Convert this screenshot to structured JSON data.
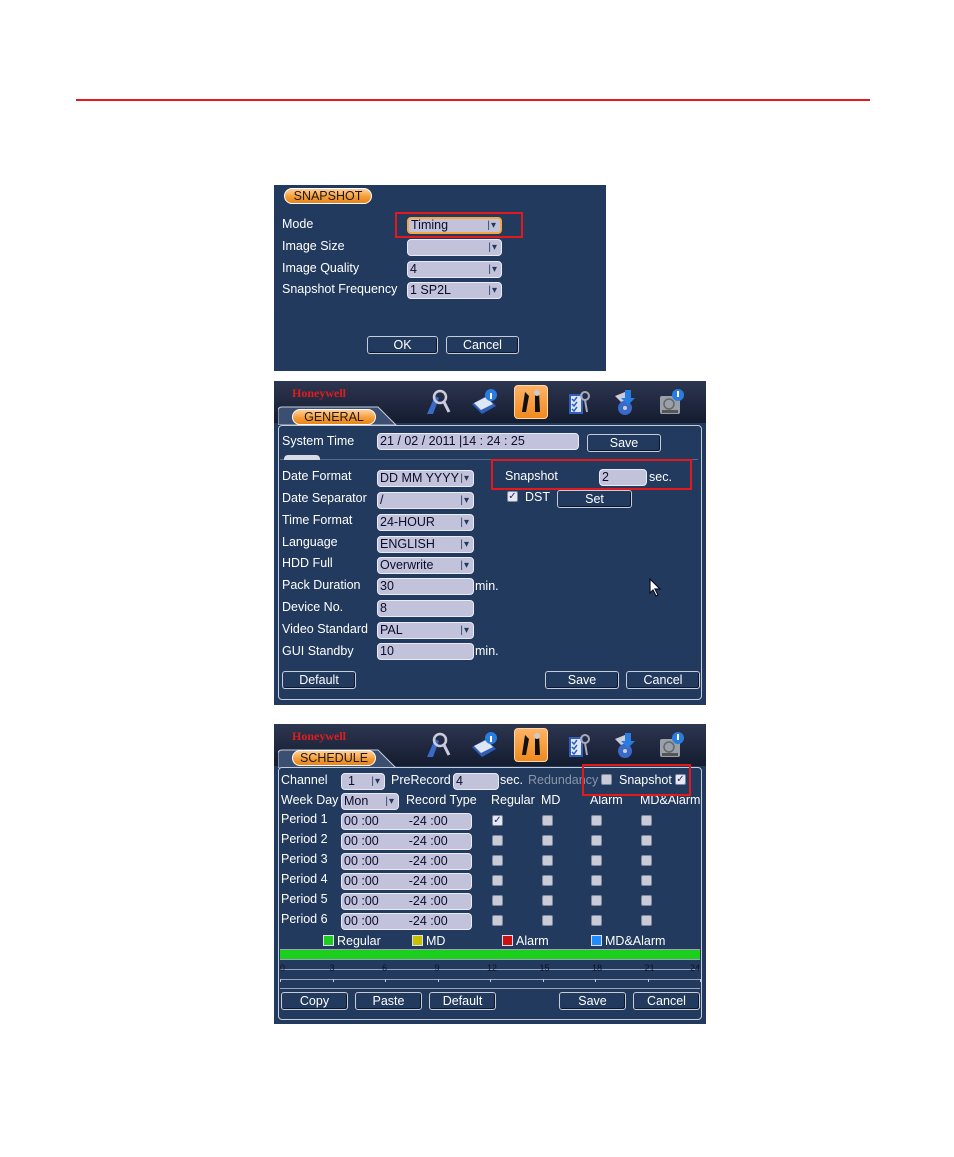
{
  "colors": {
    "rule": "#e3191b",
    "panel_bg": "#223a5e",
    "field_bg": "#c2c3db",
    "tab_orange": "#f59a32",
    "brand_red": "#e01c1c",
    "highlight_box": "#e3191b",
    "legend_regular": "#1ccf1c",
    "legend_md": "#c8c000",
    "legend_alarm": "#cc1010",
    "legend_md_alarm": "#1e8cff"
  },
  "snapshot_dialog": {
    "tab": "SNAPSHOT",
    "rows": [
      {
        "label": "Mode",
        "value": "Timing",
        "type": "select"
      },
      {
        "label": "Image Size",
        "value": "",
        "type": "select"
      },
      {
        "label": "Image Quality",
        "value": "4",
        "type": "select"
      },
      {
        "label": "Snapshot Frequency",
        "value": "1 SP2L",
        "type": "select"
      }
    ],
    "ok": "OK",
    "cancel": "Cancel"
  },
  "general_dialog": {
    "brand": "Honeywell",
    "menu_icons": [
      "search-icon",
      "info-icon",
      "settings-tools-icon",
      "security-checklist-icon",
      "backup-icon",
      "shutdown-icon"
    ],
    "tab": "GENERAL",
    "system_time_label": "System Time",
    "system_time_value": "21 / 02 / 2011   |14 : 24 : 25",
    "save_time": "Save",
    "rows": [
      {
        "label": "Date Format",
        "value": "DD MM YYYY",
        "type": "select"
      },
      {
        "label": "Date Separator",
        "value": "/",
        "type": "select"
      },
      {
        "label": "Time Format",
        "value": "24-HOUR",
        "type": "select"
      },
      {
        "label": "Language",
        "value": "ENGLISH",
        "type": "select"
      },
      {
        "label": "HDD Full",
        "value": "Overwrite",
        "type": "select"
      },
      {
        "label": "Pack Duration",
        "value": "30",
        "type": "input",
        "unit": "min."
      },
      {
        "label": "Device No.",
        "value": "8",
        "type": "input"
      },
      {
        "label": "Video Standard",
        "value": "PAL",
        "type": "select"
      },
      {
        "label": "GUI Standby",
        "value": "10",
        "type": "input",
        "unit": "min."
      }
    ],
    "snapshot_label": "Snapshot",
    "snapshot_value": "2",
    "snapshot_unit": "sec.",
    "dst_label": "DST",
    "dst_checked": true,
    "set": "Set",
    "default": "Default",
    "save": "Save",
    "cancel": "Cancel"
  },
  "schedule_dialog": {
    "brand": "Honeywell",
    "tab": "SCHEDULE",
    "channel_label": "Channel",
    "channel_value": "1",
    "prerecord_label": "PreRecord",
    "prerecord_value": "4",
    "prerecord_unit": "sec.",
    "redundancy_label": "Redundancy",
    "redundancy_checked": false,
    "snapshot_label": "Snapshot",
    "snapshot_checked": true,
    "weekday_label": "Week Day",
    "weekday_value": "Mon",
    "record_type_label": "Record Type",
    "columns": [
      "Regular",
      "MD",
      "Alarm",
      "MD&Alarm"
    ],
    "periods": [
      {
        "label": "Period 1",
        "start": "00 :00",
        "end": "-24 :00",
        "checks": [
          true,
          false,
          false,
          false
        ]
      },
      {
        "label": "Period 2",
        "start": "00 :00",
        "end": "-24 :00",
        "checks": [
          false,
          false,
          false,
          false
        ]
      },
      {
        "label": "Period 3",
        "start": "00 :00",
        "end": "-24 :00",
        "checks": [
          false,
          false,
          false,
          false
        ]
      },
      {
        "label": "Period 4",
        "start": "00 :00",
        "end": "-24 :00",
        "checks": [
          false,
          false,
          false,
          false
        ]
      },
      {
        "label": "Period 5",
        "start": "00 :00",
        "end": "-24 :00",
        "checks": [
          false,
          false,
          false,
          false
        ]
      },
      {
        "label": "Period 6",
        "start": "00 :00",
        "end": "-24 :00",
        "checks": [
          false,
          false,
          false,
          false
        ]
      }
    ],
    "legend": [
      "Regular",
      "MD",
      "Alarm",
      "MD&Alarm"
    ],
    "timeline_ticks": [
      "0",
      "3",
      "6",
      "9",
      "12",
      "15",
      "18",
      "21",
      "24"
    ],
    "timeline_regular_span_hours": [
      0,
      24
    ],
    "copy": "Copy",
    "paste": "Paste",
    "default": "Default",
    "save": "Save",
    "cancel": "Cancel"
  }
}
